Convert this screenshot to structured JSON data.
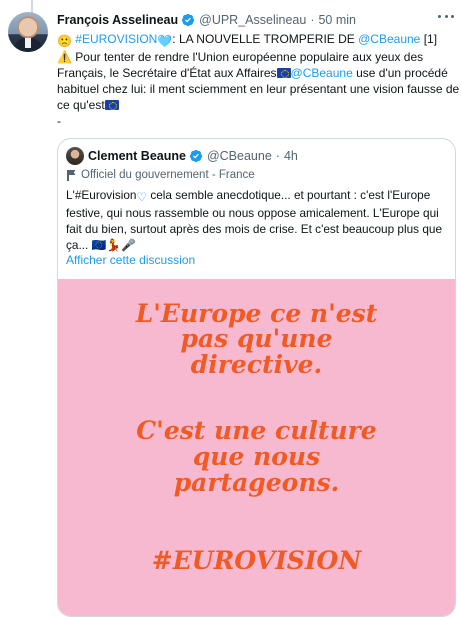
{
  "tweet": {
    "author_name": "François Asselineau",
    "handle": "@UPR_Asselineau",
    "separator": "·",
    "time": "50 min",
    "lines": {
      "l1_prefix": "🙁",
      "l1_hashtag": "#EUROVISION",
      "l1_heart": "🩵",
      "l1_mid": ": LA NOUVELLE TROMPERIE DE ",
      "l1_mention": "@CBeaune",
      "l1_suffix": " [1]",
      "l2": "⚠️ Pour tenter de rendre l'Union européenne populaire aux yeux des",
      "l3_prefix": "Français, le Secrétaire d'État aux Affaires",
      "l3_mention": "@CBeaune",
      "l3_suffix": " use d'un procédé",
      "l4": "habituel chez lui: il ment sciemment en leur présentant une vision fausse de",
      "l5": "ce qu'est",
      "l6": "-"
    }
  },
  "quote": {
    "author_name": "Clement Beaune",
    "handle": "@CBeaune",
    "separator": "·",
    "time": "4h",
    "label": "Officiel du gouvernement - France",
    "lines": {
      "l1_prefix": "L'",
      "l1_hashtag": "#Eurovision",
      "l1_suffix": " cela semble anecdotique... et pourtant : c'est l'Europe",
      "l2": "festive, qui nous rassemble ou nous oppose amicalement. L'Europe qui",
      "l3": "fait du bien, surtout après des mois de crise. Et c'est beaucoup plus que",
      "l4": "ça... 🇪🇺💃🎤"
    },
    "show_thread": "Afficher cette discussion"
  },
  "poster": {
    "line1": "L'Europe ce n'est",
    "line2": "pas qu'une",
    "line3": "directive.",
    "line4": "C'est une culture",
    "line5": "que nous",
    "line6": "partageons.",
    "line7": "#EUROVISION"
  },
  "colors": {
    "link": "#1d9bf0",
    "verified": "#1d9bf0",
    "poster_bg": "#f6b9cf",
    "poster_text": "#f15a22"
  },
  "icons": {
    "verified": "verified-badge-icon",
    "more": "more-icon",
    "official_flag": "flag-icon",
    "eu_flag": "eu-flag-icon"
  }
}
